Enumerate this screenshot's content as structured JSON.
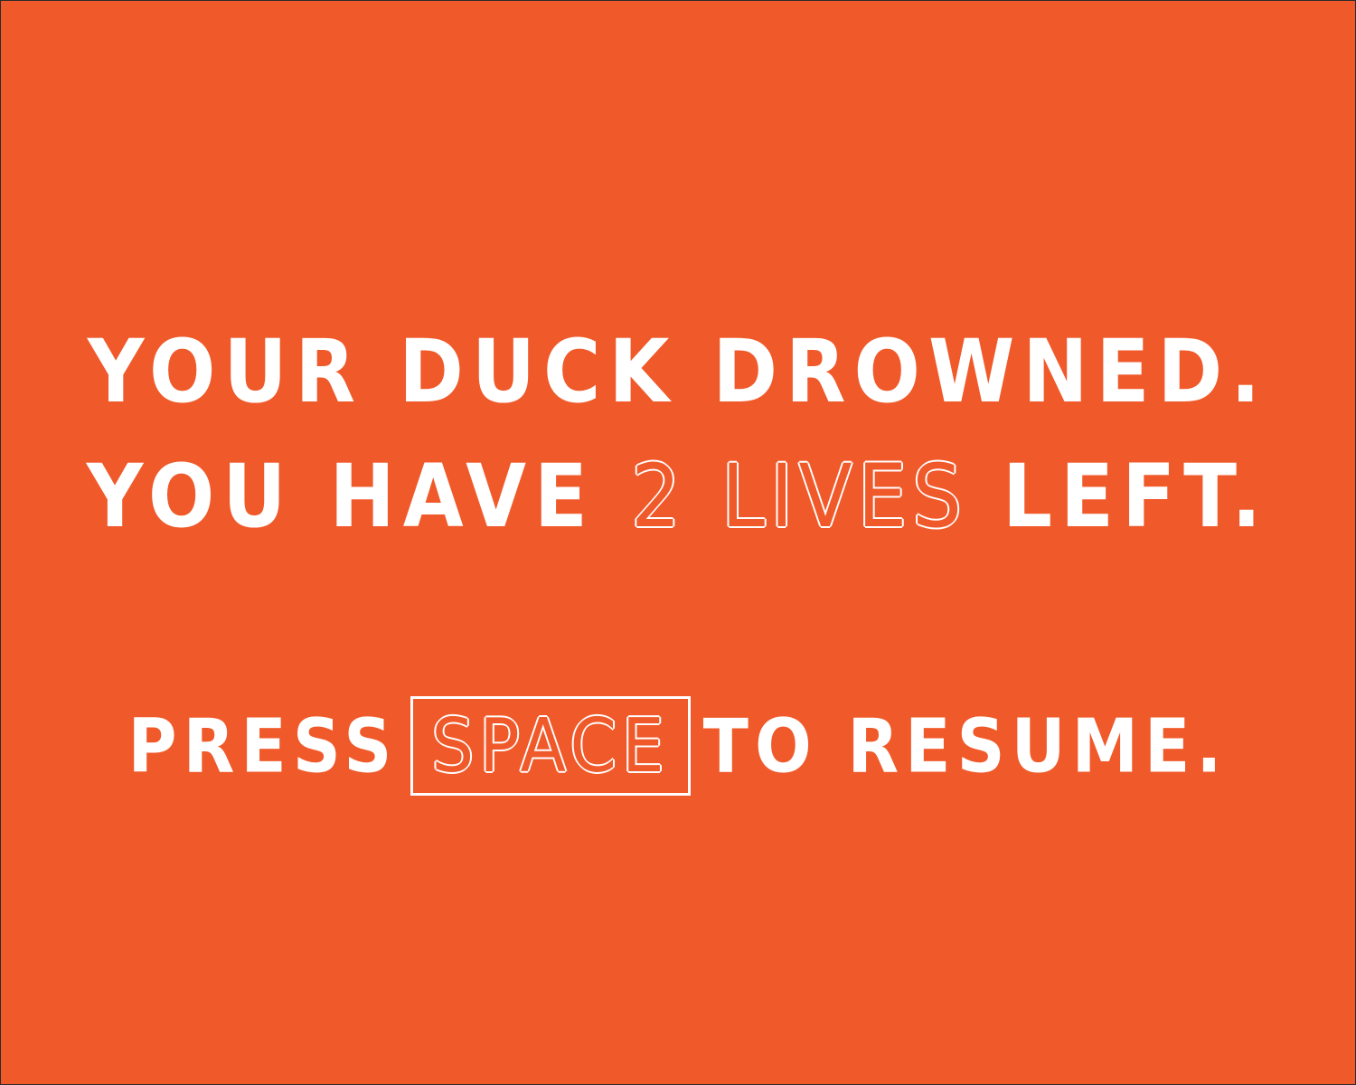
{
  "colors": {
    "background": "#f05a2b",
    "text": "#ffffff"
  },
  "message": {
    "line1": "YOUR DUCK DROWNED.",
    "line2_prefix": "YOU HAVE",
    "lives_count": "2",
    "lives_word": "LIVES",
    "line2_suffix": "LEFT.",
    "press_label": "PRESS",
    "key_label": "SPACE",
    "resume_label": "TO RESUME."
  }
}
